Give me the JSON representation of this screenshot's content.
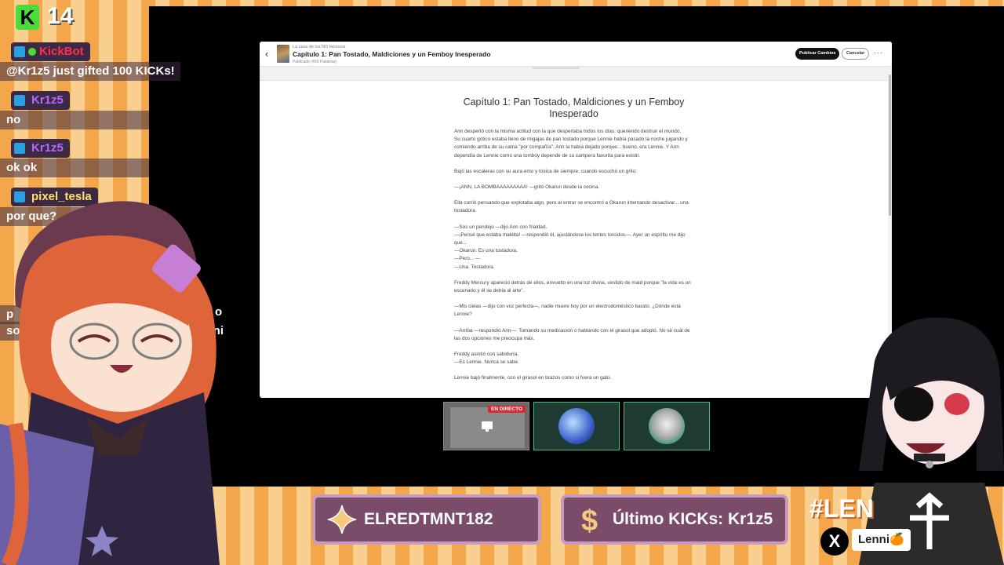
{
  "overlay": {
    "viewer_count": "14",
    "kick_logo": "K",
    "chat": [
      {
        "user": "KickBot",
        "color": "#ff2d55",
        "message": "@Kr1z5 just gifted 100 KICKs!",
        "verified": true
      },
      {
        "user": "Kr1z5",
        "color": "#b468ff",
        "message": "no"
      },
      {
        "user": "Kr1z5",
        "color": "#b468ff",
        "message": "ok ok"
      },
      {
        "user": "pixel_tesla",
        "color": "#ffe26a",
        "message": "por que?"
      }
    ],
    "partial_chat": [
      "p",
      "o",
      "sol",
      "e, ni",
      "nom",
      "es"
    ],
    "goals": [
      {
        "icon": "sparkle-icon",
        "text": "ELREDTMNT182"
      },
      {
        "icon": "dollar-icon",
        "text": "Último KICKs: Kr1z5"
      }
    ],
    "hashtag": "#LEN",
    "social_handle": "Lenni🍊",
    "social_icon": "x-logo-icon"
  },
  "editor": {
    "series_title": "La casa de los NO famosos",
    "chapter_title": "Capítulo 1: Pan Tostado, Maldiciones y un Femboy Inesperado",
    "status": "Publicado (455 Palabras)",
    "publish_button": "Publicar Cambios",
    "cancel_button": "Cancelar",
    "more": "···",
    "document_title": "Capítulo 1: Pan Tostado, Maldiciones y un Femboy Inesperado",
    "paragraphs": [
      "Ann despertó con la misma actitud con la que despertaba todos los días: queriendo destruir el mundo.",
      "Su cuarto gótico estaba lleno de migajas de pan tostado porque Lennie había pasado la noche jugando y comiendo arriba de su cama \"por compañía\". Ann la había dejado porque... bueno, era Lennie. Y Ann dependía de Lennie como una tomboy depende de su campera favorita para existir.",
      "Bajó las escaleras con su aura emo y tóxica de siempre, cuando escuchó un grito:",
      "—¡ANN, LA BOMBAAAAAAAAA! —gritó Okarun desde la cocina.",
      "Ella corrió pensando que explotaba algo, pero al entrar se encontró a Okarun intentando desactivar... una tostadora.",
      "—Sos un pendejo —dijo Ann con frialdad.",
      "—¡Pensé que estaba maldita! —respondió él, ajustándose los lentes torcidos—. Ayer un espíritu me dijo que...",
      "—Okarun. Es una tostadora.",
      "—Pero... —",
      "—Una. Tostadora.",
      "Freddy Mercury apareció detrás de ellos, envuelto en una luz divina, vestido de maid porque \"la vida es un escenario y él se debía al arte\".",
      "—Mis cielas —dijo con voz perfecta—, nadie muere hoy por un electrodoméstico barato. ¿Dónde está Lennie?",
      "—Arriba —respondió Ann—. Tomando su medicación o hablando con el girasol que adoptó. No sé cuál de las dos opciones me preocupa más.",
      "Freddy asintió con sabiduría.",
      "—Es Lennie. Nunca se sabe.",
      "Lennie bajó finalmente, con el girasol en brazos como si fuera un gato."
    ],
    "gaps_before": [
      false,
      false,
      true,
      true,
      true,
      true,
      false,
      false,
      false,
      false,
      true,
      true,
      true,
      true,
      false,
      true
    ]
  },
  "thumbnails": [
    {
      "badge": "EN DIRECTO",
      "icon": "screen-share-icon"
    },
    {
      "icon": "avatar-thumb-1"
    },
    {
      "icon": "avatar-thumb-2"
    }
  ],
  "colors": {
    "kick_green": "#4bdc3a",
    "stripe_dark": "#f4a64a",
    "stripe_light": "#f8cf8e",
    "goal_purple": "#7a4c6a",
    "live_red": "#d8292f"
  }
}
